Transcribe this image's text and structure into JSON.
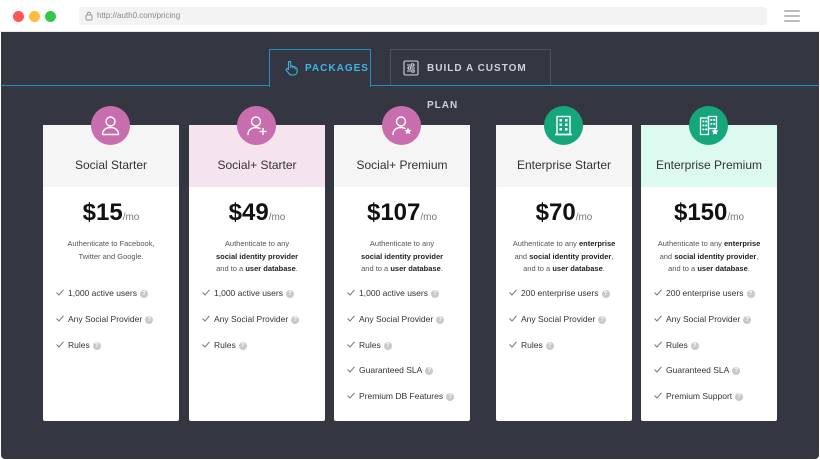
{
  "browser": {
    "url": "http://auth0.com/pricing"
  },
  "tabs": [
    {
      "label": "PACKAGES",
      "icon": "hand-pointer-icon",
      "active": true
    },
    {
      "label": "BUILD A CUSTOM PLAN",
      "icon": "sliders-icon",
      "active": false
    }
  ],
  "colors": {
    "background": "#343642",
    "accent": "#3fb6e5",
    "badge_pink": "#c86eae",
    "badge_teal": "#15a77b"
  },
  "plans": [
    {
      "name": "Social Starter",
      "icon": "user-icon",
      "price": "$15",
      "period": "/mo",
      "description": [
        "Authenticate to Facebook,",
        "Twitter and Google."
      ],
      "features": [
        "1,000 active users",
        "Any Social Provider",
        "Rules"
      ]
    },
    {
      "name": "Social+ Starter",
      "icon": "user-plus-icon",
      "price": "$49",
      "period": "/mo",
      "description": [
        "Authenticate to any",
        "social identity provider",
        "and to a",
        "user database",
        "."
      ],
      "features": [
        "1,000 active users",
        "Any Social Provider",
        "Rules"
      ]
    },
    {
      "name": "Social+ Premium",
      "icon": "user-star-icon",
      "price": "$107",
      "period": "/mo",
      "description": [
        "Authenticate to any",
        "social identity provider",
        "and to a",
        "user database",
        "."
      ],
      "features": [
        "1,000 active users",
        "Any Social Provider",
        "Rules",
        "Guaranteed SLA",
        "Premium DB Features"
      ]
    },
    {
      "name": "Enterprise Starter",
      "icon": "building-icon",
      "price": "$70",
      "period": "/mo",
      "description": [
        "Authenticate to any",
        "enterprise",
        "and",
        "social identity provider",
        ",",
        "and to a",
        "user database",
        "."
      ],
      "features": [
        "200 enterprise users",
        "Any Social Provider",
        "Rules"
      ]
    },
    {
      "name": "Enterprise Premium",
      "icon": "buildings-star-icon",
      "price": "$150",
      "period": "/mo",
      "description": [
        "Authenticate to any",
        "enterprise",
        "and",
        "social identity provider",
        ",",
        "and to a",
        "user database",
        "."
      ],
      "features": [
        "200 enterprise users",
        "Any Social Provider",
        "Rules",
        "Guaranteed SLA",
        "Premium Support"
      ]
    }
  ]
}
